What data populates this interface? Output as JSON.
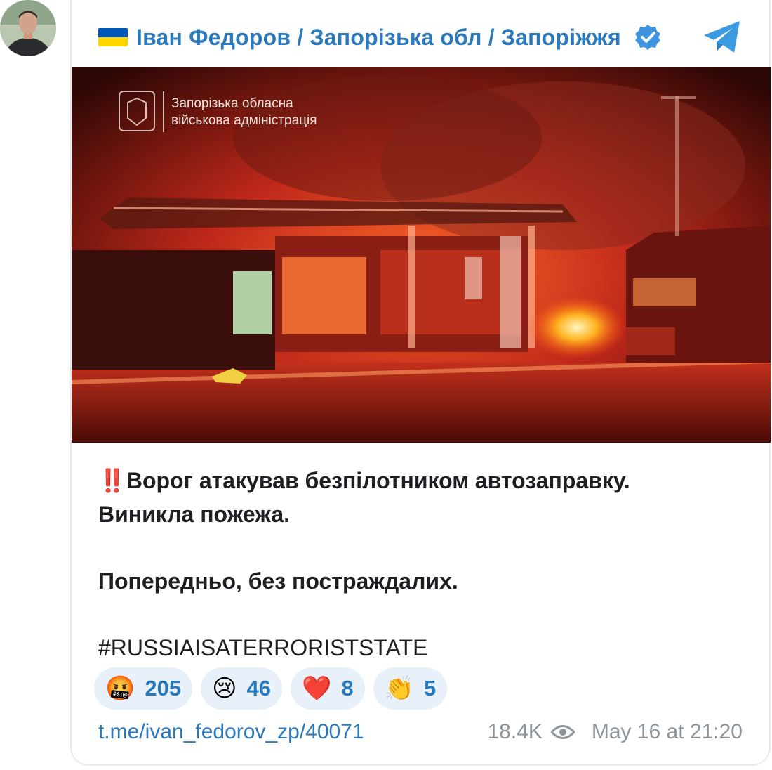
{
  "post": {
    "channel_name": "Іван Федоров / Запорізька обл / Запоріжжя",
    "image_watermark_line1": "Запорізька обласна",
    "image_watermark_line2": "військова адміністрація",
    "line1_prefix": "‼️",
    "line1": "Ворог атакував безпілотником автозаправку.",
    "line2": "Виникла пожежа.",
    "line3": "Попередньо, без постраждалих.",
    "hashtag": "#RUSSIAISATERRORISTSTATE",
    "link": "t.me/ivan_fedorov_zp/40071",
    "views": "18.4K",
    "date": "May 16 at 21:20"
  },
  "reactions": [
    {
      "emoji": "🤬",
      "count": "205"
    },
    {
      "emoji": "😢",
      "count": "46"
    },
    {
      "emoji": "❤️",
      "count": "8"
    },
    {
      "emoji": "👏",
      "count": "5"
    }
  ],
  "colors": {
    "accent": "#2a79bd",
    "reaction_bg": "#e8f1fa",
    "flag_blue": "#0057b7",
    "flag_yellow": "#ffd700"
  },
  "icons": [
    "ukraine-flag-icon",
    "verified-badge-icon",
    "telegram-logo-icon",
    "eye-icon"
  ]
}
